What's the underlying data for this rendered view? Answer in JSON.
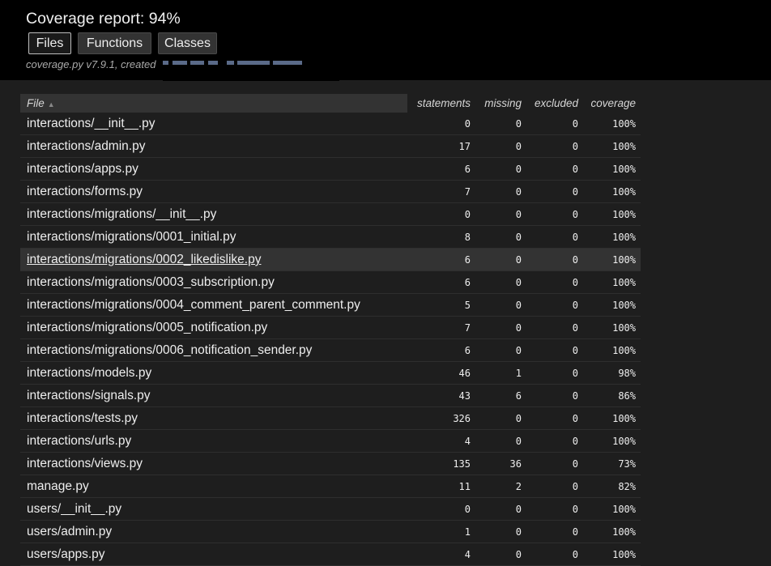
{
  "header": {
    "title": "Coverage report: 94%",
    "tabs": [
      "Files",
      "Functions",
      "Classes"
    ],
    "meta": "coverage.py v7.9.1, created"
  },
  "table": {
    "columns": {
      "file": "File",
      "statements": "statements",
      "missing": "missing",
      "excluded": "excluded",
      "coverage": "coverage"
    },
    "rows": [
      {
        "file": "interactions/__init__.py",
        "statements": "0",
        "missing": "0",
        "excluded": "0",
        "coverage": "100%"
      },
      {
        "file": "interactions/admin.py",
        "statements": "17",
        "missing": "0",
        "excluded": "0",
        "coverage": "100%"
      },
      {
        "file": "interactions/apps.py",
        "statements": "6",
        "missing": "0",
        "excluded": "0",
        "coverage": "100%"
      },
      {
        "file": "interactions/forms.py",
        "statements": "7",
        "missing": "0",
        "excluded": "0",
        "coverage": "100%"
      },
      {
        "file": "interactions/migrations/__init__.py",
        "statements": "0",
        "missing": "0",
        "excluded": "0",
        "coverage": "100%"
      },
      {
        "file": "interactions/migrations/0001_initial.py",
        "statements": "8",
        "missing": "0",
        "excluded": "0",
        "coverage": "100%"
      },
      {
        "file": "interactions/migrations/0002_likedislike.py",
        "statements": "6",
        "missing": "0",
        "excluded": "0",
        "coverage": "100%"
      },
      {
        "file": "interactions/migrations/0003_subscription.py",
        "statements": "6",
        "missing": "0",
        "excluded": "0",
        "coverage": "100%"
      },
      {
        "file": "interactions/migrations/0004_comment_parent_comment.py",
        "statements": "5",
        "missing": "0",
        "excluded": "0",
        "coverage": "100%"
      },
      {
        "file": "interactions/migrations/0005_notification.py",
        "statements": "7",
        "missing": "0",
        "excluded": "0",
        "coverage": "100%"
      },
      {
        "file": "interactions/migrations/0006_notification_sender.py",
        "statements": "6",
        "missing": "0",
        "excluded": "0",
        "coverage": "100%"
      },
      {
        "file": "interactions/models.py",
        "statements": "46",
        "missing": "1",
        "excluded": "0",
        "coverage": "98%"
      },
      {
        "file": "interactions/signals.py",
        "statements": "43",
        "missing": "6",
        "excluded": "0",
        "coverage": "86%"
      },
      {
        "file": "interactions/tests.py",
        "statements": "326",
        "missing": "0",
        "excluded": "0",
        "coverage": "100%"
      },
      {
        "file": "interactions/urls.py",
        "statements": "4",
        "missing": "0",
        "excluded": "0",
        "coverage": "100%"
      },
      {
        "file": "interactions/views.py",
        "statements": "135",
        "missing": "36",
        "excluded": "0",
        "coverage": "73%"
      },
      {
        "file": "manage.py",
        "statements": "11",
        "missing": "2",
        "excluded": "0",
        "coverage": "82%"
      },
      {
        "file": "users/__init__.py",
        "statements": "0",
        "missing": "0",
        "excluded": "0",
        "coverage": "100%"
      },
      {
        "file": "users/admin.py",
        "statements": "1",
        "missing": "0",
        "excluded": "0",
        "coverage": "100%"
      },
      {
        "file": "users/apps.py",
        "statements": "4",
        "missing": "0",
        "excluded": "0",
        "coverage": "100%"
      }
    ]
  },
  "icons": {
    "sort": "sort-ascending-icon"
  }
}
